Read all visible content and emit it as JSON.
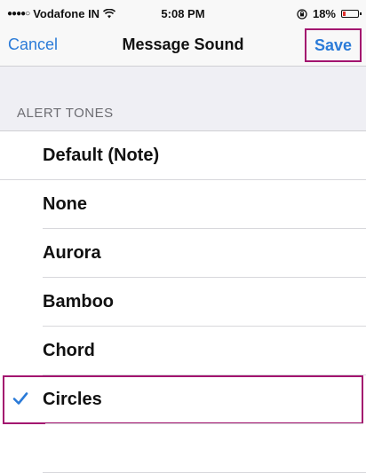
{
  "status_bar": {
    "signal": "●●●●○",
    "carrier": "Vodafone IN",
    "time": "5:08 PM",
    "battery_percent": "18%",
    "battery_level": 0.18,
    "icons": [
      "wifi-icon",
      "orientation-lock-icon",
      "battery-icon"
    ]
  },
  "nav": {
    "cancel_label": "Cancel",
    "title": "Message Sound",
    "save_label": "Save"
  },
  "section": {
    "header": "ALERT TONES"
  },
  "tones": [
    {
      "label": "Default (Note)",
      "selected": false
    },
    {
      "label": "None",
      "selected": false
    },
    {
      "label": "Aurora",
      "selected": false
    },
    {
      "label": "Bamboo",
      "selected": false
    },
    {
      "label": "Chord",
      "selected": false
    },
    {
      "label": "Circles",
      "selected": true
    }
  ],
  "colors": {
    "accent": "#2b7bd8",
    "highlight": "#a3146f",
    "background": "#efeff4"
  }
}
